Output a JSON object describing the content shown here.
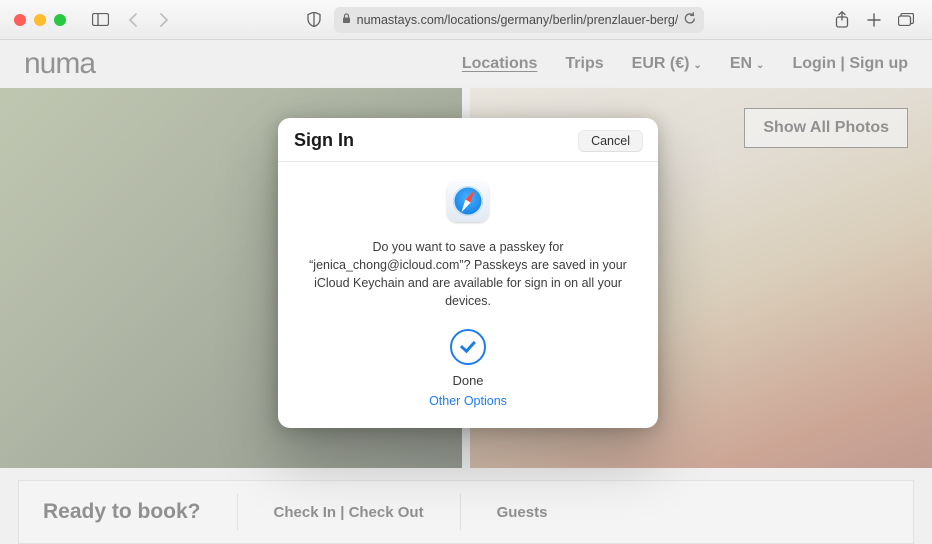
{
  "browser": {
    "url": "numastays.com/locations/germany/berlin/prenzlauer-berg/"
  },
  "site": {
    "logo": "numa",
    "nav": {
      "locations": "Locations",
      "trips": "Trips",
      "currency": "EUR (€)",
      "language": "EN",
      "auth": "Login | Sign up"
    },
    "show_all_photos": "Show All Photos",
    "booking": {
      "ready": "Ready to book?",
      "check": "Check In | Check Out",
      "guests": "Guests"
    }
  },
  "dialog": {
    "title": "Sign In",
    "cancel": "Cancel",
    "message": "Do you want to save a passkey for “jenica_chong@icloud.com”? Passkeys are saved in your iCloud Keychain and are available for sign in on all your devices.",
    "done": "Done",
    "other_options": "Other Options"
  }
}
